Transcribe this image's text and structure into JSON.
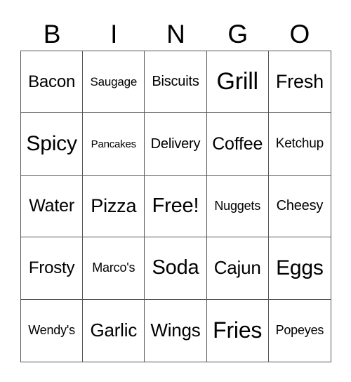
{
  "header": [
    "B",
    "I",
    "N",
    "G",
    "O"
  ],
  "cells": [
    [
      "Bacon",
      "Saugage",
      "Biscuits",
      "Grill",
      "Fresh"
    ],
    [
      "Spicy",
      "Pancakes",
      "Delivery",
      "Coffee",
      "Ketchup"
    ],
    [
      "Water",
      "Pizza",
      "Free!",
      "Nuggets",
      "Cheesy"
    ],
    [
      "Frosty",
      "Marco's",
      "Soda",
      "Cajun",
      "Eggs"
    ],
    [
      "Wendy's",
      "Garlic",
      "Wings",
      "Fries",
      "Popeyes"
    ]
  ]
}
